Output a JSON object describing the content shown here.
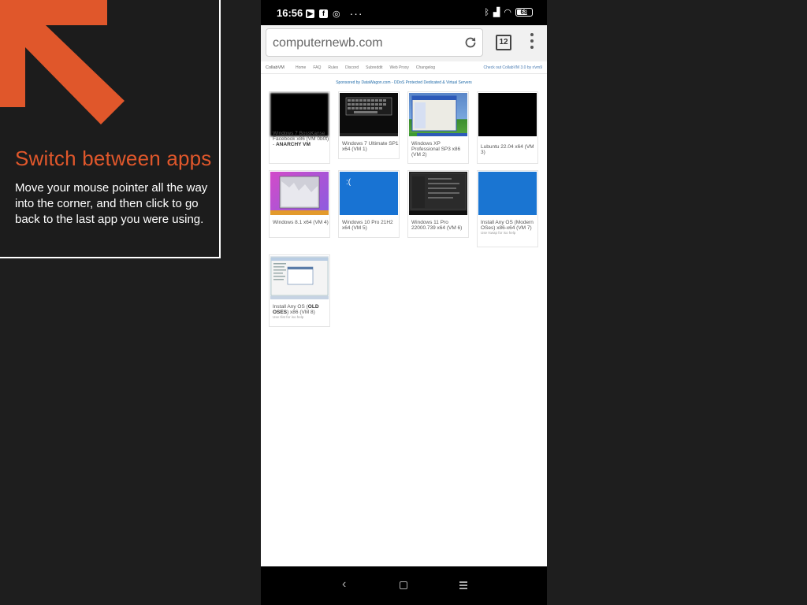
{
  "tip": {
    "title": "Switch between apps",
    "body": "Move your mouse pointer all the way into the corner, and then click to go back to the last app you were using.",
    "accent_color": "#e0572b"
  },
  "status_bar": {
    "time": "16:56",
    "battery": "68"
  },
  "browser": {
    "url": "computernewb.com",
    "tab_count": "12"
  },
  "site_nav": {
    "logo": "CollabVM",
    "links": [
      "Home",
      "FAQ",
      "Rules",
      "Discord",
      "Subreddit",
      "Web Proxy",
      "Changelog"
    ],
    "right_link": "Check out CollabVM 3.0 by r/vm9"
  },
  "sponsor_text": "Sponsored by DataWagon.com - DDoS Protected Dedicated & Virtual Servers",
  "vms": [
    {
      "label": "Windows 7 BossKanse Facebook x86 (VM 0b0t) - ",
      "bold": "ANARCHY VM",
      "sub": ""
    },
    {
      "label": "Windows 7 Ultimate SP1 x64 (VM 1)",
      "bold": "",
      "sub": ""
    },
    {
      "label": "Windows XP Professional SP3 x86 (VM 2)",
      "bold": "",
      "sub": ""
    },
    {
      "label": "Lubuntu 22.04 x64 (VM 3)",
      "bold": "",
      "sub": ""
    },
    {
      "label": "Windows 8.1 x64 (VM 4)",
      "bold": "",
      "sub": ""
    },
    {
      "label": "Windows 10 Pro 21H2 x64 (VM 5)",
      "bold": "",
      "sub": ""
    },
    {
      "label": "Windows 11 Pro 22000.739 x64 (VM 6)",
      "bold": "",
      "sub": ""
    },
    {
      "label": "Install Any OS (Modern OSes) x86-x64 (VM 7)",
      "bold": "",
      "sub": "Use !swap for iso help"
    },
    {
      "label": "Install Any OS (",
      "bold": "OLD OSES",
      "label2": ") x86 (VM 8)",
      "sub": "Use !list for iso help"
    }
  ]
}
